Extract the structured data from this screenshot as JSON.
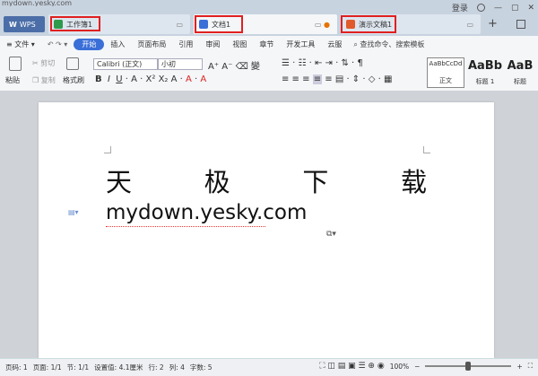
{
  "url_fragment": "mydown.yesky.com",
  "tabs": {
    "wps": "WPS",
    "sheet": "工作簿1",
    "doc": "文档1",
    "ppt": "演示文稿1",
    "add": "+"
  },
  "window": {
    "login": "登录"
  },
  "menu": {
    "file": "≡ 文件 ▾",
    "items": [
      "开始",
      "插入",
      "页面布局",
      "引用",
      "审阅",
      "视图",
      "章节",
      "开发工具",
      "云服"
    ],
    "search": "查找命令、搜索模板"
  },
  "ribbon": {
    "paste": "粘贴",
    "cut": "剪切",
    "copy": "复制",
    "format_painter": "格式刷",
    "font_name": "Calibri (正文)",
    "font_size": "小初",
    "styles": [
      {
        "preview": "AaBbCcDd",
        "name": "正文"
      },
      {
        "preview": "AaBb",
        "name": "标题 1"
      },
      {
        "preview": "AaB",
        "name": "标题"
      }
    ]
  },
  "document": {
    "title_chars": [
      "天",
      "极",
      "下",
      "载"
    ],
    "url_line": "mydown.yesky.com"
  },
  "status": {
    "page_num": "页码: 1",
    "pages": "页面: 1/1",
    "section": "节: 1/1",
    "setting": "设置值: 4.1厘米",
    "row": "行: 2",
    "col": "列: 4",
    "words": "字数: 5",
    "zoom": "100%",
    "zoom_level": 0.5
  },
  "colors": {
    "accent": "#3b6fd8",
    "highlight_box": "#e02020",
    "sheet_icon": "#2e9a4b",
    "doc_icon": "#3b6fd8",
    "ppt_icon": "#e05a2b"
  }
}
